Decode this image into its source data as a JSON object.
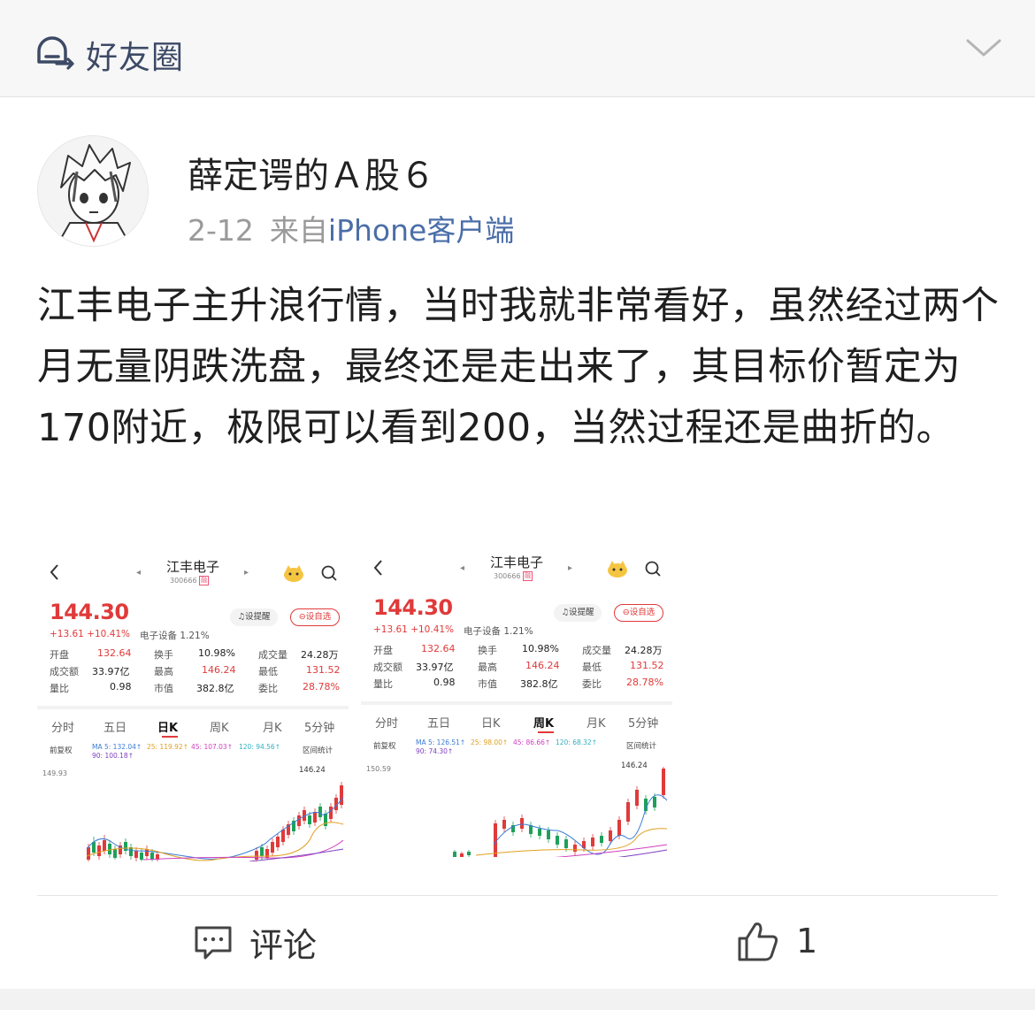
{
  "header": {
    "title": "好友圈",
    "icon": "group-chat-icon",
    "collapse_icon": "chevron-down-icon"
  },
  "post": {
    "author": "薛定谔的Ａ股６",
    "date": "2-12",
    "source_prefix": "来自",
    "source_device": "iPhone",
    "source_suffix": "客户端",
    "text": "江丰电子主升浪行情，当时我就非常看好，虽然经过两个月无量阴跌洗盘，最终还是走出来了，其目标价暂定为170附近，极限可以看到200，当然过程还是曲折的。"
  },
  "cards": [
    {
      "name": "江丰电子",
      "code": "300666",
      "mark": "融",
      "nav_prev": "◂",
      "nav_next": "▸",
      "price": "144.30",
      "change": "+13.61  +10.41%",
      "sector": "电子设备 1.21%",
      "remind": "♫设提醒",
      "add_fav": "⊖设自选",
      "stats": [
        [
          "开盘",
          "132.64",
          "换手",
          "10.98%",
          "成交量",
          "24.28万"
        ],
        [
          "成交额",
          "33.97亿",
          "最高",
          "146.24",
          "最低",
          "131.52"
        ],
        [
          "量比",
          "0.98",
          "市值",
          "382.8亿",
          "委比",
          "28.78%"
        ]
      ],
      "tabs": [
        "分时",
        "五日",
        "日K",
        "周K",
        "月K",
        "5分钟"
      ],
      "active_tab": 2,
      "fq": "前复权",
      "ma": [
        "MA 5: 132.04↑",
        "25: 119.92↑",
        "45: 107.03↑",
        "120: 94.56↑",
        "90: 100.18↑"
      ],
      "qjtj": "区间统计",
      "y_top": "149.93",
      "high_label": "146.24"
    },
    {
      "name": "江丰电子",
      "code": "300666",
      "mark": "融",
      "nav_prev": "◂",
      "nav_next": "▸",
      "price": "144.30",
      "change": "+13.61  +10.41%",
      "sector": "电子设备 1.21%",
      "remind": "♫设提醒",
      "add_fav": "⊖设自选",
      "stats": [
        [
          "开盘",
          "132.64",
          "换手",
          "10.98%",
          "成交量",
          "24.28万"
        ],
        [
          "成交额",
          "33.97亿",
          "最高",
          "146.24",
          "最低",
          "131.52"
        ],
        [
          "量比",
          "0.98",
          "市值",
          "382.8亿",
          "委比",
          "28.78%"
        ]
      ],
      "tabs": [
        "分时",
        "五日",
        "日K",
        "周K",
        "月K",
        "5分钟"
      ],
      "active_tab": 3,
      "fq": "前复权",
      "ma": [
        "MA 5: 126.51↑",
        "25: 98.00↑",
        "45: 86.66↑",
        "120: 68.32↑",
        "90: 74.30↑"
      ],
      "qjtj": "区间统计",
      "y_top": "150.59",
      "high_label": "146.24"
    }
  ],
  "footer": {
    "comment_label": "评论",
    "like_count": "1"
  },
  "colors": {
    "up": "#e03a3a",
    "down": "#1fa05a",
    "link": "#4a6ea8",
    "header_text": "#3d4a66"
  }
}
